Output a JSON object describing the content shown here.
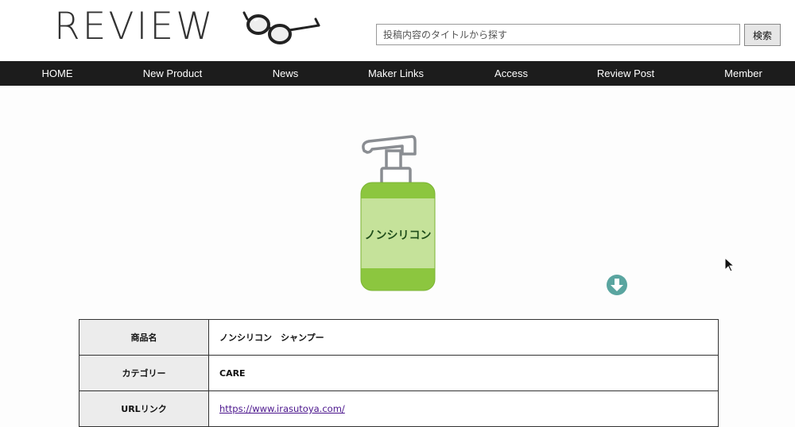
{
  "header": {
    "logo": "REVIEW",
    "logo_icon": "glasses-icon",
    "search": {
      "placeholder": "投稿内容のタイトルから探す",
      "button_label": "検索"
    }
  },
  "nav": {
    "items": [
      {
        "label": "HOME"
      },
      {
        "label": "New Product"
      },
      {
        "label": "News"
      },
      {
        "label": "Maker Links"
      },
      {
        "label": "Access"
      },
      {
        "label": "Review Post"
      },
      {
        "label": "Member"
      }
    ]
  },
  "product": {
    "image_label": "ノンシリコン",
    "image_icon": "shampoo-bottle-icon"
  },
  "details": {
    "rows": [
      {
        "label": "商品名",
        "value": "ノンシリコン　シャンプー"
      },
      {
        "label": "カテゴリー",
        "value": "CARE"
      },
      {
        "label": "URLリンク",
        "value": "https://www.irasutoya.com/"
      }
    ]
  },
  "colors": {
    "nav_bg": "#1c1c1c",
    "bottle_green": "#8cc63f",
    "bottle_label": "#c5e29a",
    "download_icon": "#5aa5a0",
    "link": "#4a148c"
  }
}
